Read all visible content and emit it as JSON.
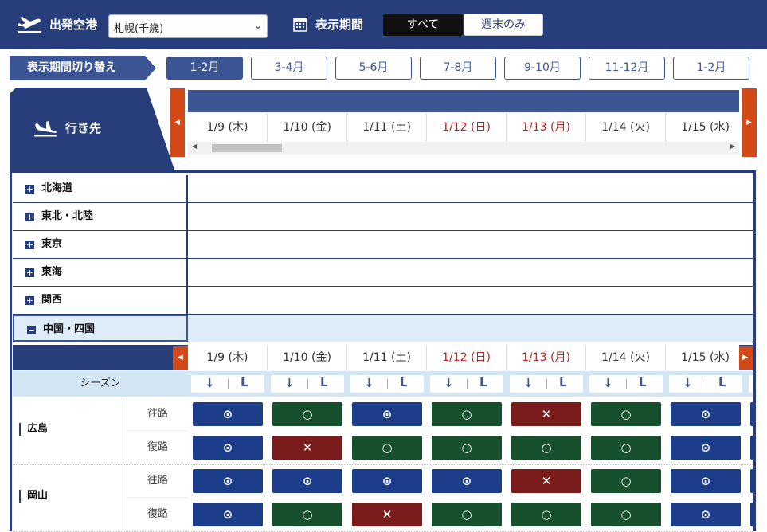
{
  "header": {
    "departure_label": "出発空港",
    "departure_value": "札幌(千歳)",
    "period_label": "表示期間",
    "period_all": "すべて",
    "period_weekend": "週末のみ"
  },
  "switch": {
    "label": "表示期間切り替え",
    "months": [
      "1-2月",
      "3-4月",
      "5-6月",
      "7-8月",
      "9-10月",
      "11-12月",
      "1-2月"
    ],
    "active_index": 0
  },
  "destination_label": "行き先",
  "dates": [
    {
      "label": "1/9 (木)",
      "holiday": false
    },
    {
      "label": "1/10 (金)",
      "holiday": false
    },
    {
      "label": "1/11 (土)",
      "holiday": false
    },
    {
      "label": "1/12 (日)",
      "holiday": true
    },
    {
      "label": "1/13 (月)",
      "holiday": true
    },
    {
      "label": "1/14 (火)",
      "holiday": false
    },
    {
      "label": "1/15 (水)",
      "holiday": false
    }
  ],
  "regions": [
    {
      "name": "北海道",
      "open": false
    },
    {
      "name": "東北・北陸",
      "open": false
    },
    {
      "name": "東京",
      "open": false
    },
    {
      "name": "東海",
      "open": false
    },
    {
      "name": "関西",
      "open": false
    },
    {
      "name": "中国・四国",
      "open": true
    }
  ],
  "season_label": "シーズン",
  "season_marks": {
    "arrow": "↓",
    "letter": "L"
  },
  "routes": [
    {
      "city": "広島",
      "outbound_label": "往路",
      "return_label": "復路",
      "outbound": [
        "b",
        "g",
        "b",
        "g",
        "r",
        "g",
        "b"
      ],
      "return": [
        "b",
        "r",
        "g",
        "g",
        "g",
        "g",
        "b"
      ]
    },
    {
      "city": "岡山",
      "outbound_label": "往路",
      "return_label": "復路",
      "outbound": [
        "b",
        "b",
        "b",
        "b",
        "r",
        "g",
        "b"
      ],
      "return": [
        "b",
        "g",
        "r",
        "g",
        "g",
        "g",
        "b"
      ]
    }
  ],
  "status_symbols": {
    "b": "⊙",
    "g": "○",
    "r": "✕"
  },
  "colors": {
    "navy": "#283e7a",
    "blue_status": "#1c3d8a",
    "green_status": "#17502d",
    "red_status": "#7b1c1c",
    "accent_orange": "#d34a18",
    "holiday_red": "#c0201f"
  }
}
